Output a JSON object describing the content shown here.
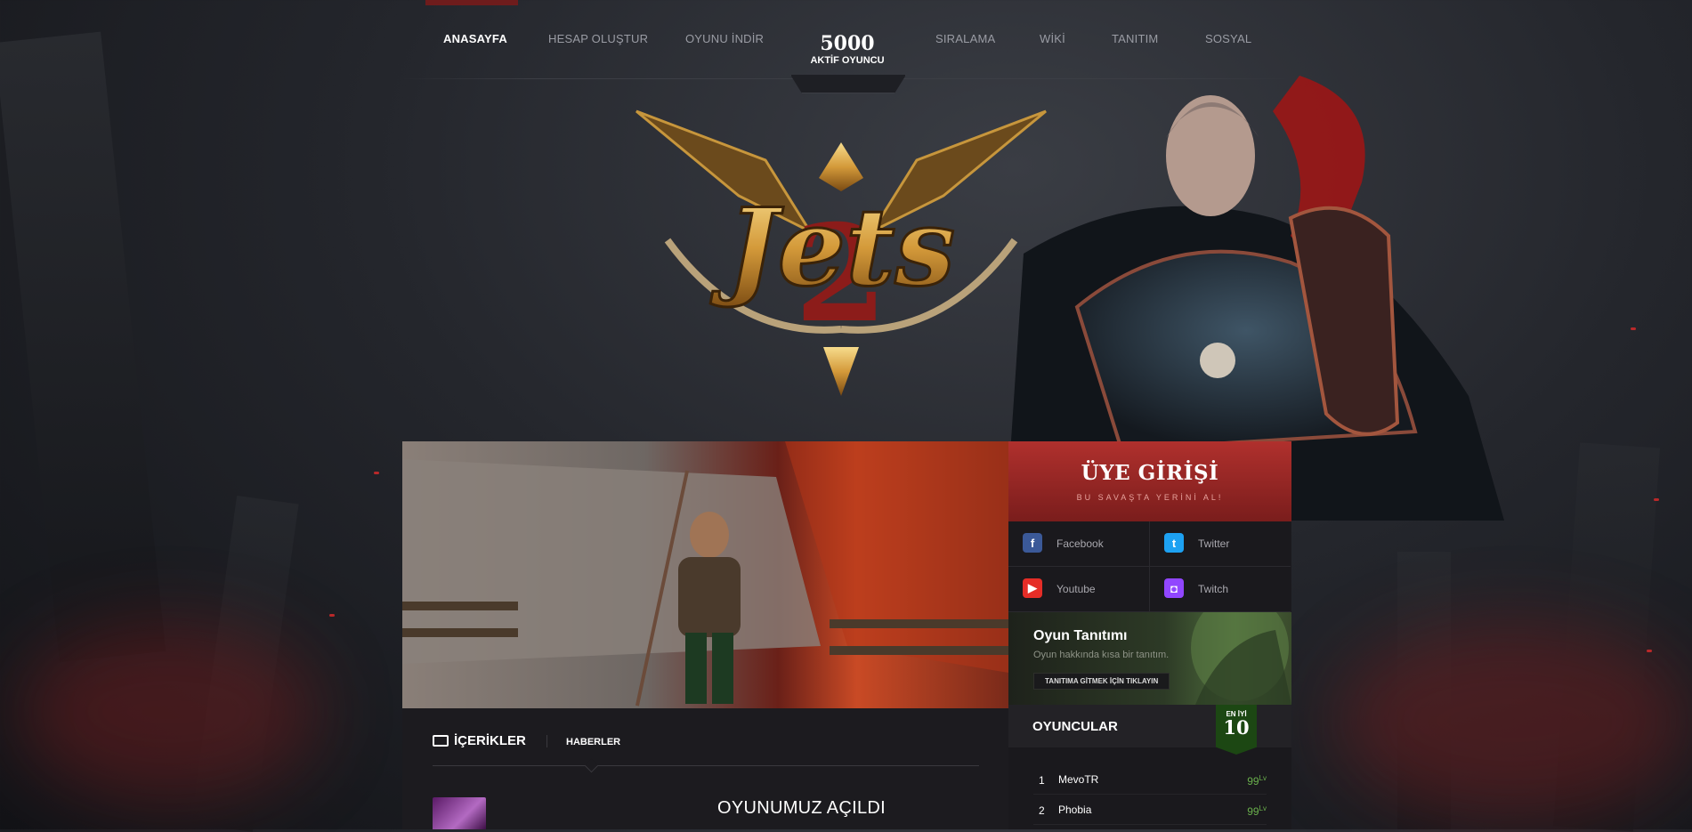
{
  "nav": {
    "items": [
      "ANASAYFA",
      "HESAP OLUŞTUR",
      "OYUNU İNDİR",
      "SIRALAMA",
      "WİKİ",
      "TANITIM",
      "SOSYAL"
    ],
    "active": "ANASAYFA",
    "counter": {
      "value": "5000",
      "label": "AKTİF OYUNCU"
    }
  },
  "logo": {
    "text": "Jets",
    "number": "2"
  },
  "login": {
    "title": "ÜYE GİRİŞİ",
    "subtitle": "BU SAVAŞTA YERİNİ AL!"
  },
  "socials": [
    {
      "label": "Facebook",
      "icon": "facebook-icon",
      "color": "#3b5998"
    },
    {
      "label": "Twitter",
      "icon": "twitter-icon",
      "color": "#1da1f2"
    },
    {
      "label": "Youtube",
      "icon": "youtube-icon",
      "color": "#e52d27"
    },
    {
      "label": "Twitch",
      "icon": "twitch-icon",
      "color": "#9146ff"
    }
  ],
  "promo": {
    "title": "Oyun Tanıtımı",
    "subtitle": "Oyun hakkında kısa bir tanıtım.",
    "button": "TANITIMA GİTMEK İÇİN TIKLAYIN"
  },
  "players": {
    "title": "OYUNCULAR",
    "best_label": "EN İYİ",
    "best_count": "10",
    "rows": [
      {
        "rank": "1",
        "name": "MevoTR",
        "level": "99",
        "unit": "Lv"
      },
      {
        "rank": "2",
        "name": "Phobia",
        "level": "99",
        "unit": "Lv"
      }
    ]
  },
  "content": {
    "section": "İÇERİKLER",
    "tab": "HABERLER",
    "news_title": "OYUNUMUZ AÇILDI"
  },
  "colors": {
    "accent_red": "#b0302d",
    "level_green": "#6ab04c",
    "best_badge": "#1c4713"
  }
}
